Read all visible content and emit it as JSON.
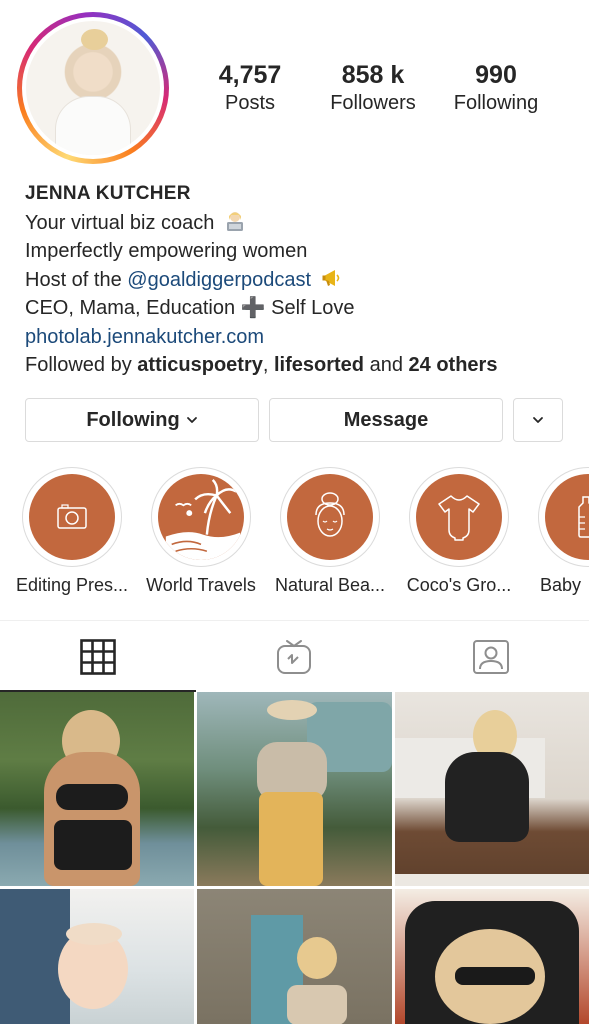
{
  "profile": {
    "stats": {
      "posts": {
        "value": "4,757",
        "label": "Posts"
      },
      "followers": {
        "value": "858 k",
        "label": "Followers"
      },
      "following": {
        "value": "990",
        "label": "Following"
      }
    },
    "name": "JENNA KUTCHER",
    "bio": {
      "line1": "Your virtual biz coach",
      "line2": "Imperfectly empowering women",
      "line3_prefix": "Host of the",
      "line3_handle": "@goaldiggerpodcast",
      "line4": "CEO, Mama, Education ➕ Self Love",
      "website": "photolab.jennakutcher.com",
      "followed_by_prefix": "Followed by",
      "followed_user1": "atticuspoetry",
      "followed_sep": ",",
      "followed_user2": "lifesorted",
      "followed_and": "and",
      "followed_others": "24 others"
    }
  },
  "actions": {
    "following_label": "Following",
    "message_label": "Message"
  },
  "highlights": [
    {
      "label": "Editing Pres...",
      "icon": "camera-icon"
    },
    {
      "label": "World Travels",
      "icon": "palm-beach-icon"
    },
    {
      "label": "Natural Bea...",
      "icon": "face-icon"
    },
    {
      "label": "Coco's Gro...",
      "icon": "onesie-icon"
    },
    {
      "label": "Baby",
      "icon": "bottle-icon"
    }
  ],
  "tabs": [
    {
      "name": "grid",
      "icon": "grid-icon",
      "active": true
    },
    {
      "name": "igtv",
      "icon": "igtv-icon",
      "active": false
    },
    {
      "name": "tagged",
      "icon": "tagged-person-icon",
      "active": false
    }
  ],
  "colors": {
    "highlight_bg": "#c2683e",
    "link": "#1c4a7a",
    "text": "#262626",
    "border": "#dbdbdb"
  }
}
